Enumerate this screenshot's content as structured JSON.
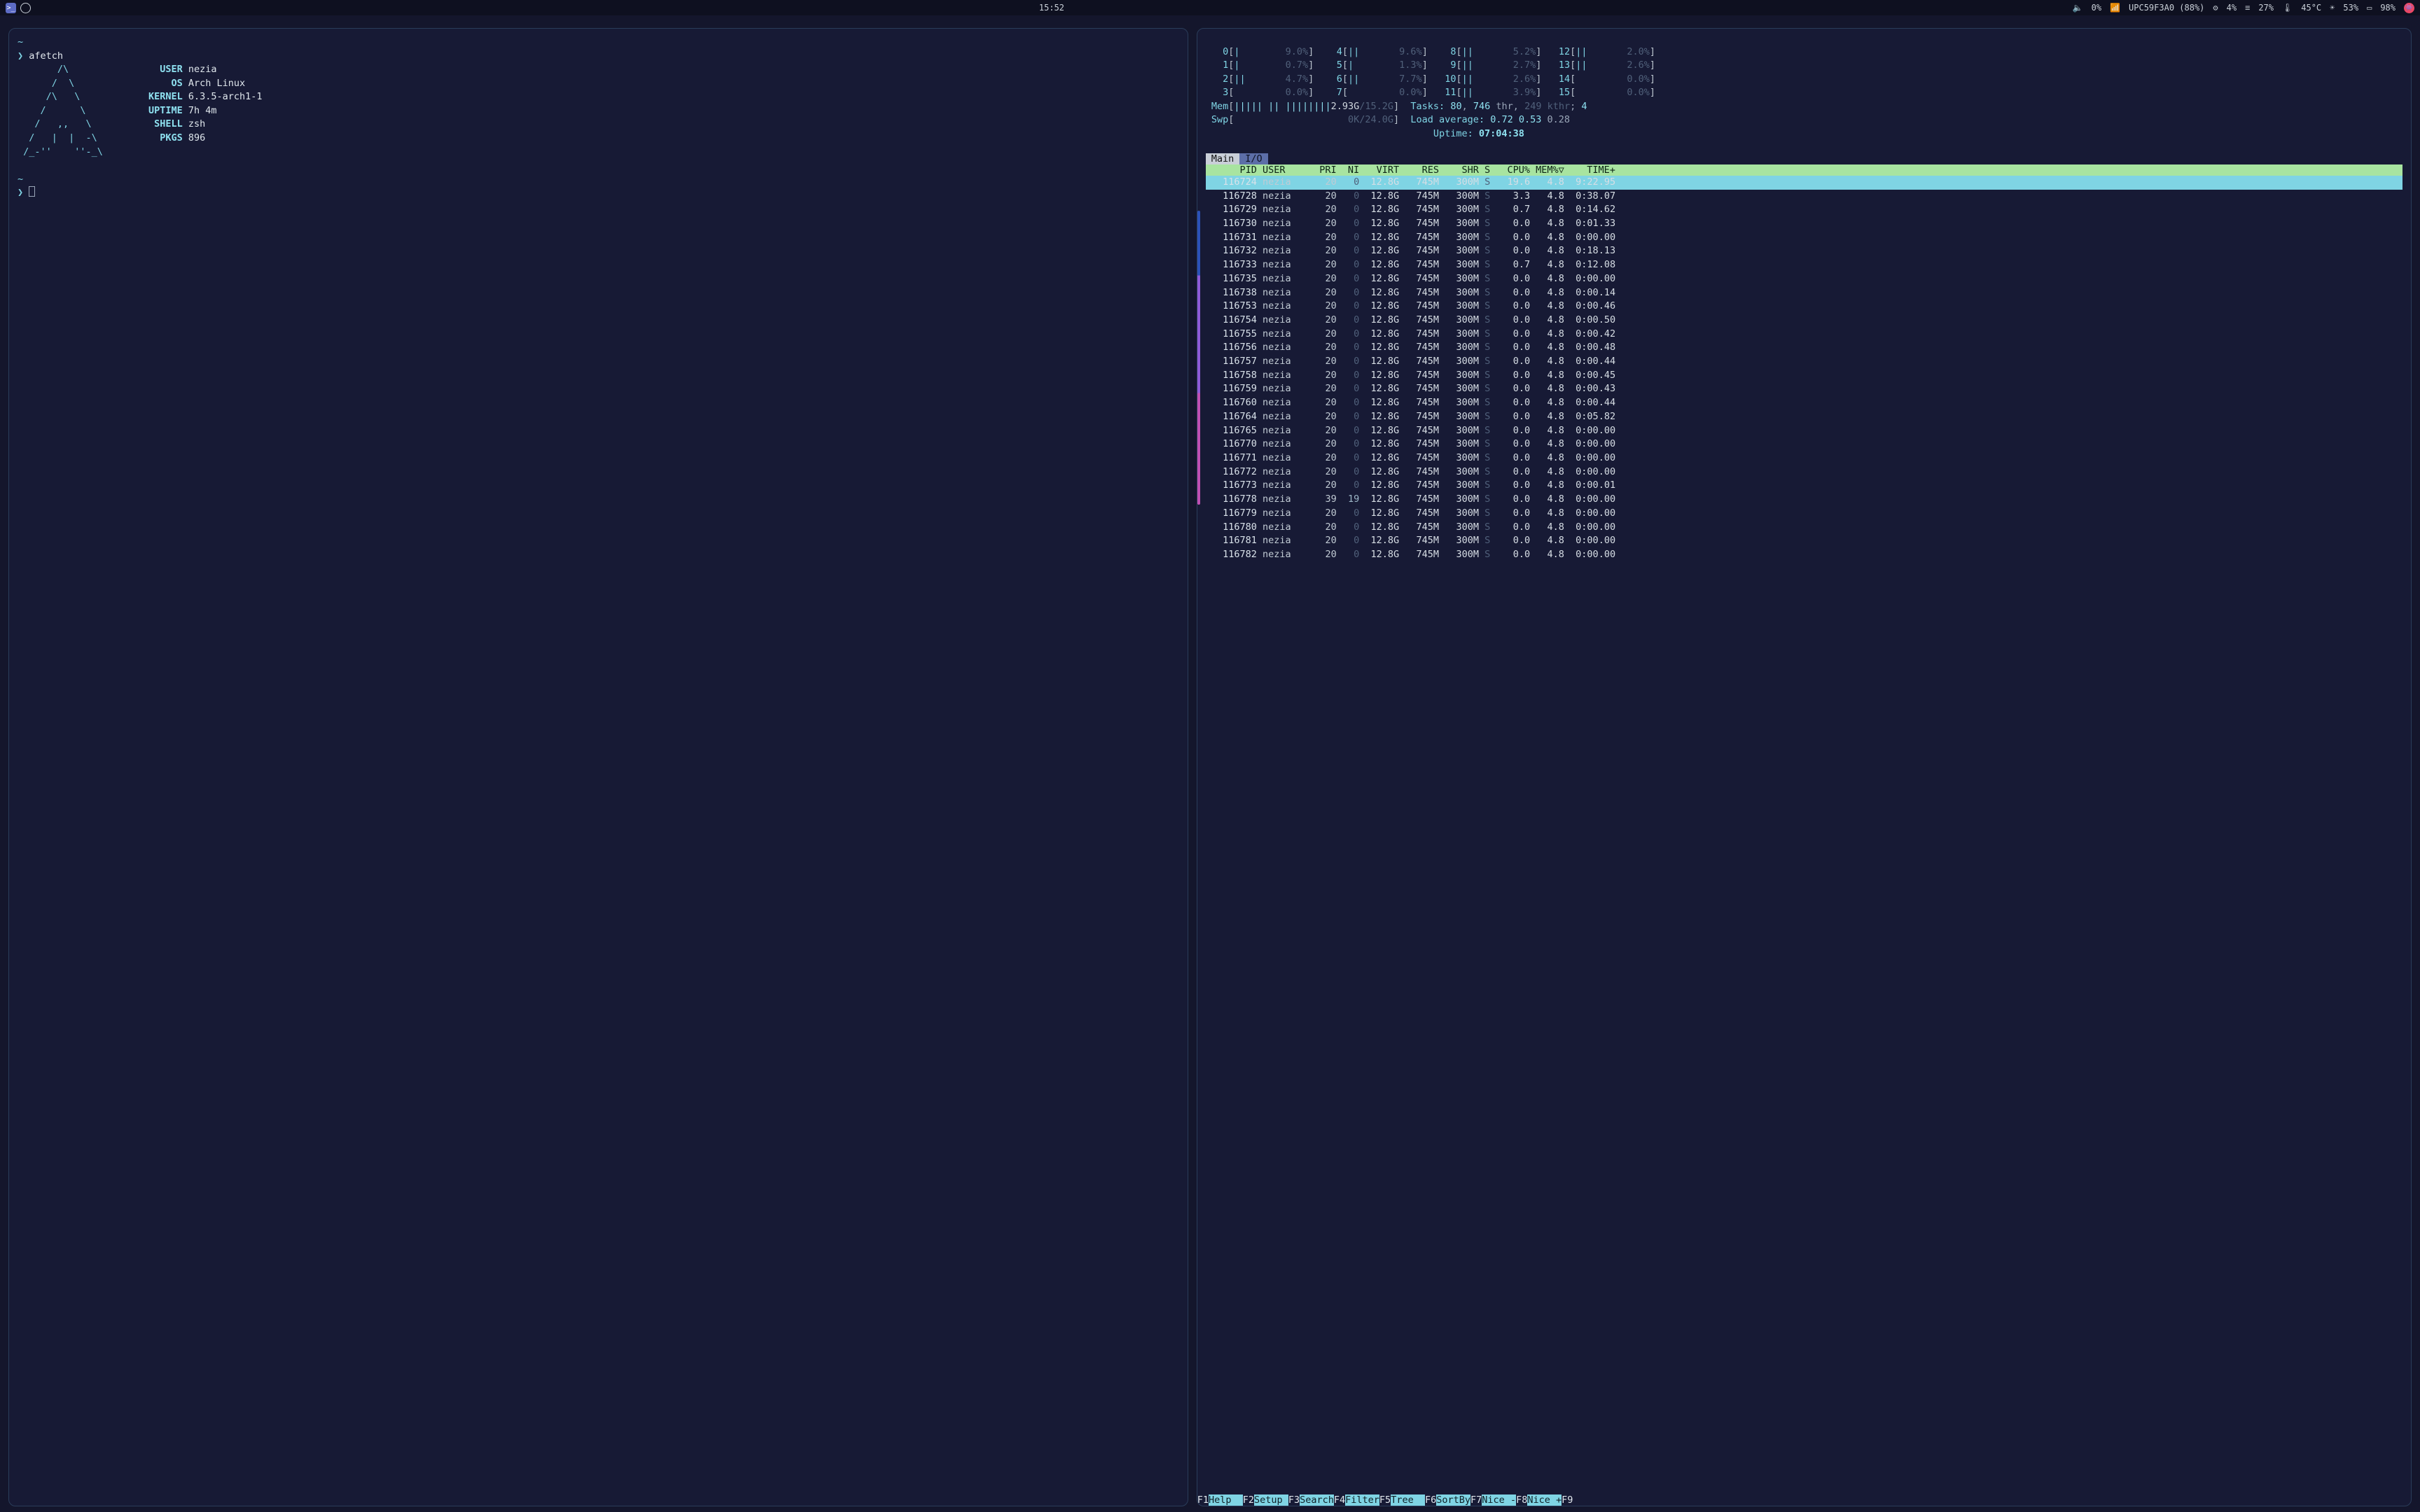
{
  "topbar": {
    "clock": "15:52",
    "vol": "0%",
    "wifi": "UPC59F3A0 (88%)",
    "gear": "4%",
    "menu": "27%",
    "temp": "45°C",
    "sun": "53%",
    "bat": "98%"
  },
  "left": {
    "prompt": "❯",
    "cmd": "afetch",
    "ascii": [
      "       /\\",
      "      /  \\",
      "     /\\   \\",
      "    /      \\",
      "   /   ,,   \\",
      "  /   |  |  -\\",
      " /_-''    ''-_\\"
    ],
    "info": [
      {
        "label": "USER",
        "value": "nezia"
      },
      {
        "label": "OS",
        "value": "Arch Linux"
      },
      {
        "label": "KERNEL",
        "value": "6.3.5-arch1-1"
      },
      {
        "label": "UPTIME",
        "value": "7h 4m"
      },
      {
        "label": "SHELL",
        "value": "zsh"
      },
      {
        "label": "PKGS",
        "value": "896"
      }
    ]
  },
  "htop": {
    "cpus": [
      {
        "n": 0,
        "bar": "|",
        "pct": "9.0%"
      },
      {
        "n": 1,
        "bar": "|",
        "pct": "0.7%"
      },
      {
        "n": 2,
        "bar": "||",
        "pct": "4.7%"
      },
      {
        "n": 3,
        "bar": "",
        "pct": "0.0%"
      },
      {
        "n": 4,
        "bar": "||",
        "pct": "9.6%"
      },
      {
        "n": 5,
        "bar": "|",
        "pct": "1.3%"
      },
      {
        "n": 6,
        "bar": "||",
        "pct": "7.7%"
      },
      {
        "n": 7,
        "bar": "",
        "pct": "0.0%"
      },
      {
        "n": 8,
        "bar": "||",
        "pct": "5.2%"
      },
      {
        "n": 9,
        "bar": "||",
        "pct": "2.7%"
      },
      {
        "n": 10,
        "bar": "||",
        "pct": "2.6%"
      },
      {
        "n": 11,
        "bar": "||",
        "pct": "3.9%"
      },
      {
        "n": 12,
        "bar": "||",
        "pct": "2.0%"
      },
      {
        "n": 13,
        "bar": "||",
        "pct": "2.6%"
      },
      {
        "n": 14,
        "bar": "",
        "pct": "0.0%"
      },
      {
        "n": 15,
        "bar": "",
        "pct": "0.0%"
      }
    ],
    "mem": {
      "label": "Mem",
      "bar": "||||| || ||||||||",
      "used": "2.93G",
      "total": "15.2G"
    },
    "swp": {
      "label": "Swp",
      "used": "0K",
      "total": "24.0G"
    },
    "tasks": {
      "label": "Tasks:",
      "procs": "80",
      "thr": "746",
      "thr_lbl": "thr",
      "kthr": "249",
      "kthr_lbl": "kthr",
      "run": "4"
    },
    "load": {
      "label": "Load average:",
      "a": "0.72",
      "b": "0.53",
      "c": "0.28"
    },
    "uptime": {
      "label": "Uptime:",
      "value": "07:04:38"
    },
    "tabs": {
      "main": "Main",
      "io": "I/O"
    },
    "columns": [
      "PID",
      "USER",
      "PRI",
      "NI",
      "VIRT",
      "RES",
      "SHR",
      "S",
      "CPU%",
      "MEM%▽",
      "TIME+"
    ],
    "rows": [
      {
        "pid": "116724",
        "user": "nezia",
        "pri": "20",
        "ni": "0",
        "virt": "12.8G",
        "res": "745M",
        "shr": "300M",
        "s": "S",
        "cpu": "19.6",
        "mem": "4.8",
        "time": "9:22.95",
        "sel": true
      },
      {
        "pid": "116728",
        "user": "nezia",
        "pri": "20",
        "ni": "0",
        "virt": "12.8G",
        "res": "745M",
        "shr": "300M",
        "s": "S",
        "cpu": "3.3",
        "mem": "4.8",
        "time": "0:38.07"
      },
      {
        "pid": "116729",
        "user": "nezia",
        "pri": "20",
        "ni": "0",
        "virt": "12.8G",
        "res": "745M",
        "shr": "300M",
        "s": "S",
        "cpu": "0.7",
        "mem": "4.8",
        "time": "0:14.62"
      },
      {
        "pid": "116730",
        "user": "nezia",
        "pri": "20",
        "ni": "0",
        "virt": "12.8G",
        "res": "745M",
        "shr": "300M",
        "s": "S",
        "cpu": "0.0",
        "mem": "4.8",
        "time": "0:01.33"
      },
      {
        "pid": "116731",
        "user": "nezia",
        "pri": "20",
        "ni": "0",
        "virt": "12.8G",
        "res": "745M",
        "shr": "300M",
        "s": "S",
        "cpu": "0.0",
        "mem": "4.8",
        "time": "0:00.00"
      },
      {
        "pid": "116732",
        "user": "nezia",
        "pri": "20",
        "ni": "0",
        "virt": "12.8G",
        "res": "745M",
        "shr": "300M",
        "s": "S",
        "cpu": "0.0",
        "mem": "4.8",
        "time": "0:18.13"
      },
      {
        "pid": "116733",
        "user": "nezia",
        "pri": "20",
        "ni": "0",
        "virt": "12.8G",
        "res": "745M",
        "shr": "300M",
        "s": "S",
        "cpu": "0.7",
        "mem": "4.8",
        "time": "0:12.08"
      },
      {
        "pid": "116735",
        "user": "nezia",
        "pri": "20",
        "ni": "0",
        "virt": "12.8G",
        "res": "745M",
        "shr": "300M",
        "s": "S",
        "cpu": "0.0",
        "mem": "4.8",
        "time": "0:00.00"
      },
      {
        "pid": "116738",
        "user": "nezia",
        "pri": "20",
        "ni": "0",
        "virt": "12.8G",
        "res": "745M",
        "shr": "300M",
        "s": "S",
        "cpu": "0.0",
        "mem": "4.8",
        "time": "0:00.14"
      },
      {
        "pid": "116753",
        "user": "nezia",
        "pri": "20",
        "ni": "0",
        "virt": "12.8G",
        "res": "745M",
        "shr": "300M",
        "s": "S",
        "cpu": "0.0",
        "mem": "4.8",
        "time": "0:00.46"
      },
      {
        "pid": "116754",
        "user": "nezia",
        "pri": "20",
        "ni": "0",
        "virt": "12.8G",
        "res": "745M",
        "shr": "300M",
        "s": "S",
        "cpu": "0.0",
        "mem": "4.8",
        "time": "0:00.50"
      },
      {
        "pid": "116755",
        "user": "nezia",
        "pri": "20",
        "ni": "0",
        "virt": "12.8G",
        "res": "745M",
        "shr": "300M",
        "s": "S",
        "cpu": "0.0",
        "mem": "4.8",
        "time": "0:00.42"
      },
      {
        "pid": "116756",
        "user": "nezia",
        "pri": "20",
        "ni": "0",
        "virt": "12.8G",
        "res": "745M",
        "shr": "300M",
        "s": "S",
        "cpu": "0.0",
        "mem": "4.8",
        "time": "0:00.48"
      },
      {
        "pid": "116757",
        "user": "nezia",
        "pri": "20",
        "ni": "0",
        "virt": "12.8G",
        "res": "745M",
        "shr": "300M",
        "s": "S",
        "cpu": "0.0",
        "mem": "4.8",
        "time": "0:00.44"
      },
      {
        "pid": "116758",
        "user": "nezia",
        "pri": "20",
        "ni": "0",
        "virt": "12.8G",
        "res": "745M",
        "shr": "300M",
        "s": "S",
        "cpu": "0.0",
        "mem": "4.8",
        "time": "0:00.45"
      },
      {
        "pid": "116759",
        "user": "nezia",
        "pri": "20",
        "ni": "0",
        "virt": "12.8G",
        "res": "745M",
        "shr": "300M",
        "s": "S",
        "cpu": "0.0",
        "mem": "4.8",
        "time": "0:00.43"
      },
      {
        "pid": "116760",
        "user": "nezia",
        "pri": "20",
        "ni": "0",
        "virt": "12.8G",
        "res": "745M",
        "shr": "300M",
        "s": "S",
        "cpu": "0.0",
        "mem": "4.8",
        "time": "0:00.44"
      },
      {
        "pid": "116764",
        "user": "nezia",
        "pri": "20",
        "ni": "0",
        "virt": "12.8G",
        "res": "745M",
        "shr": "300M",
        "s": "S",
        "cpu": "0.0",
        "mem": "4.8",
        "time": "0:05.82"
      },
      {
        "pid": "116765",
        "user": "nezia",
        "pri": "20",
        "ni": "0",
        "virt": "12.8G",
        "res": "745M",
        "shr": "300M",
        "s": "S",
        "cpu": "0.0",
        "mem": "4.8",
        "time": "0:00.00"
      },
      {
        "pid": "116770",
        "user": "nezia",
        "pri": "20",
        "ni": "0",
        "virt": "12.8G",
        "res": "745M",
        "shr": "300M",
        "s": "S",
        "cpu": "0.0",
        "mem": "4.8",
        "time": "0:00.00"
      },
      {
        "pid": "116771",
        "user": "nezia",
        "pri": "20",
        "ni": "0",
        "virt": "12.8G",
        "res": "745M",
        "shr": "300M",
        "s": "S",
        "cpu": "0.0",
        "mem": "4.8",
        "time": "0:00.00"
      },
      {
        "pid": "116772",
        "user": "nezia",
        "pri": "20",
        "ni": "0",
        "virt": "12.8G",
        "res": "745M",
        "shr": "300M",
        "s": "S",
        "cpu": "0.0",
        "mem": "4.8",
        "time": "0:00.00"
      },
      {
        "pid": "116773",
        "user": "nezia",
        "pri": "20",
        "ni": "0",
        "virt": "12.8G",
        "res": "745M",
        "shr": "300M",
        "s": "S",
        "cpu": "0.0",
        "mem": "4.8",
        "time": "0:00.01"
      },
      {
        "pid": "116778",
        "user": "nezia",
        "pri": "39",
        "ni": "19",
        "virt": "12.8G",
        "res": "745M",
        "shr": "300M",
        "s": "S",
        "cpu": "0.0",
        "mem": "4.8",
        "time": "0:00.00"
      },
      {
        "pid": "116779",
        "user": "nezia",
        "pri": "20",
        "ni": "0",
        "virt": "12.8G",
        "res": "745M",
        "shr": "300M",
        "s": "S",
        "cpu": "0.0",
        "mem": "4.8",
        "time": "0:00.00"
      },
      {
        "pid": "116780",
        "user": "nezia",
        "pri": "20",
        "ni": "0",
        "virt": "12.8G",
        "res": "745M",
        "shr": "300M",
        "s": "S",
        "cpu": "0.0",
        "mem": "4.8",
        "time": "0:00.00"
      },
      {
        "pid": "116781",
        "user": "nezia",
        "pri": "20",
        "ni": "0",
        "virt": "12.8G",
        "res": "745M",
        "shr": "300M",
        "s": "S",
        "cpu": "0.0",
        "mem": "4.8",
        "time": "0:00.00"
      },
      {
        "pid": "116782",
        "user": "nezia",
        "pri": "20",
        "ni": "0",
        "virt": "12.8G",
        "res": "745M",
        "shr": "300M",
        "s": "S",
        "cpu": "0.0",
        "mem": "4.8",
        "time": "0:00.00"
      }
    ],
    "fkeys": [
      {
        "k": "F1",
        "l": "Help  "
      },
      {
        "k": "F2",
        "l": "Setup "
      },
      {
        "k": "F3",
        "l": "Search"
      },
      {
        "k": "F4",
        "l": "Filter"
      },
      {
        "k": "F5",
        "l": "Tree  "
      },
      {
        "k": "F6",
        "l": "SortBy"
      },
      {
        "k": "F7",
        "l": "Nice -"
      },
      {
        "k": "F8",
        "l": "Nice +"
      },
      {
        "k": "F9",
        "l": ""
      }
    ]
  }
}
